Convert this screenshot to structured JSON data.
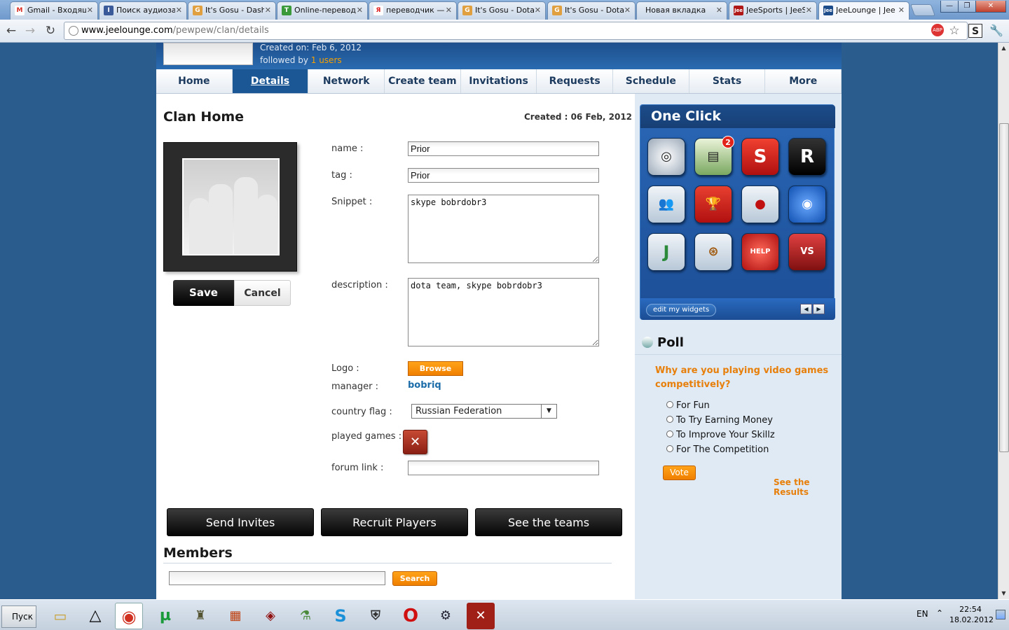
{
  "browser": {
    "tabs": [
      {
        "label": "Gmail - Входящи",
        "favicon": "gmail-icon",
        "color": "#d93025",
        "glyph": "M"
      },
      {
        "label": "Поиск аудиозап",
        "favicon": "audio-search-icon",
        "color": "#3a5a9a",
        "glyph": "I"
      },
      {
        "label": "It's Gosu - Dashb",
        "favicon": "gosu-icon",
        "color": "#e0a040",
        "glyph": "G"
      },
      {
        "label": "Online-перевод",
        "favicon": "translate-icon",
        "color": "#3a9a3a",
        "glyph": "T"
      },
      {
        "label": "переводчик — Я",
        "favicon": "yandex-icon",
        "color": "#e02020",
        "glyph": "Я"
      },
      {
        "label": "It's Gosu - Dota",
        "favicon": "gosu-icon",
        "color": "#e0a040",
        "glyph": "G"
      },
      {
        "label": "It's Gosu - Dota",
        "favicon": "gosu-icon",
        "color": "#e0a040",
        "glyph": "G"
      },
      {
        "label": "Новая вкладка",
        "favicon": "",
        "color": "",
        "glyph": ""
      },
      {
        "label": "JeeSports | JeeS",
        "favicon": "jee-icon",
        "color": "#b01818",
        "glyph": "Jee"
      },
      {
        "label": "JeeLounge | Jee",
        "favicon": "jee-icon",
        "color": "#1c4c8a",
        "glyph": "Jee",
        "active": true
      }
    ],
    "url_host": "www.jeelounge.com",
    "url_path": "/pewpew/clan/details"
  },
  "banner": {
    "created_on": "Created on: Feb 6, 2012",
    "followed_prefix": "followed by ",
    "followed_count": "1 users"
  },
  "nav": [
    {
      "label": "Home"
    },
    {
      "label": "Details",
      "active": true
    },
    {
      "label": "Network"
    },
    {
      "label": "Create team"
    },
    {
      "label": "Invitations"
    },
    {
      "label": "Requests"
    },
    {
      "label": "Schedule"
    },
    {
      "label": "Stats"
    },
    {
      "label": "More"
    }
  ],
  "clan": {
    "title": "Clan Home",
    "created": "Created : 06 Feb, 2012",
    "save_label": "Save",
    "cancel_label": "Cancel",
    "labels": {
      "name": "name :",
      "tag": "tag :",
      "snippet": "Snippet :",
      "description": "description :",
      "logo": "Logo :",
      "manager": "manager :",
      "country": "country flag :",
      "games": "played games :",
      "forum": "forum link :"
    },
    "name_value": "Prior",
    "tag_value": "Prior",
    "snippet_value": "skype bobrdobr3",
    "description_value": "dota team, skype bobrdobr3",
    "browse_label": "Browse",
    "manager_value": "bobriq",
    "country_value": "Russian Federation",
    "forum_value": ""
  },
  "actions": {
    "send_invites": "Send Invites",
    "recruit": "Recruit Players",
    "see_teams": "See the teams"
  },
  "members": {
    "title": "Members",
    "search_label": "Search"
  },
  "oneclick": {
    "title": "One Click",
    "edit_label": "edit my widgets",
    "badge": "2",
    "widgets": [
      "disc-icon",
      "inbox-icon",
      "sports-trophy-icon",
      "r-logo-icon",
      "users-help-icon",
      "tournament-add-icon",
      "boxing-glove-icon",
      "network-globe-icon",
      "jeelnet-icon",
      "search-reel-icon",
      "help-button-icon",
      "versus-icon"
    ]
  },
  "poll": {
    "title": "Poll",
    "question": "Why are you playing video games competitively?",
    "options": [
      "For Fun",
      "To Try Earning Money",
      "To Improve Your Skillz",
      "For The Competition"
    ],
    "vote_label": "Vote",
    "results_label": "See the Results"
  },
  "taskbar": {
    "start_label": "Пуск",
    "lang": "EN",
    "time": "22:54",
    "date": "18.02.2012"
  }
}
